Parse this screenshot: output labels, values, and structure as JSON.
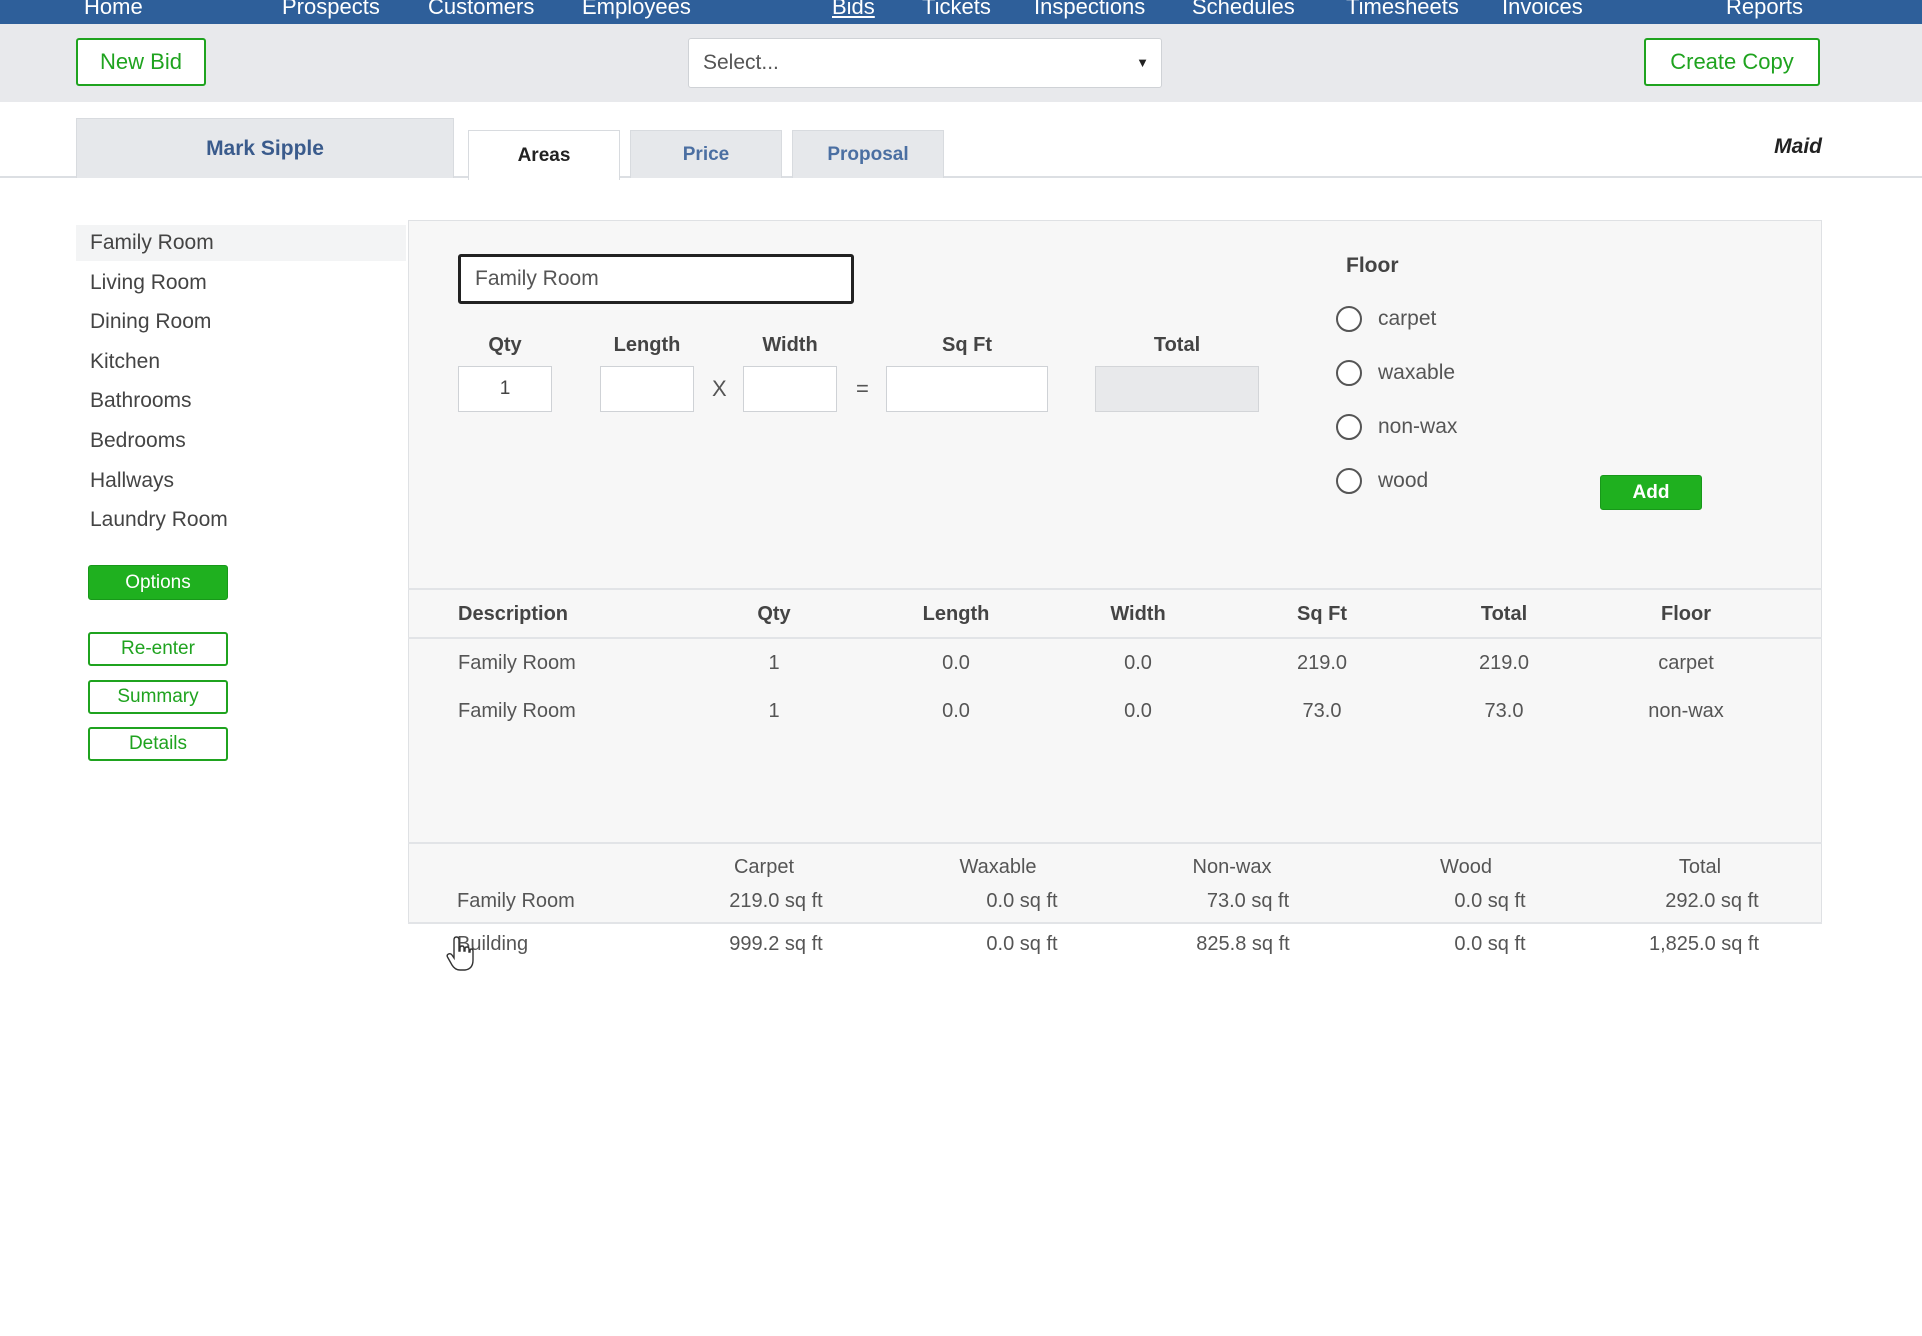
{
  "nav": {
    "items": [
      {
        "label": "Home",
        "active": false
      },
      {
        "label": "Prospects",
        "active": false
      },
      {
        "label": "Customers",
        "active": false
      },
      {
        "label": "Employees",
        "active": false
      },
      {
        "label": "Bids",
        "active": true
      },
      {
        "label": "Tickets",
        "active": false
      },
      {
        "label": "Inspections",
        "active": false
      },
      {
        "label": "Schedules",
        "active": false
      },
      {
        "label": "Timesheets",
        "active": false
      },
      {
        "label": "Invoices",
        "active": false
      },
      {
        "label": "Reports",
        "active": false
      }
    ]
  },
  "toolbar": {
    "new_bid_label": "New Bid",
    "select_placeholder": "Select...",
    "create_copy_label": "Create Copy"
  },
  "header": {
    "customer_name": "Mark Sipple",
    "tabs": [
      {
        "label": "Areas",
        "active": true
      },
      {
        "label": "Price",
        "active": false
      },
      {
        "label": "Proposal",
        "active": false
      }
    ],
    "plan_label": "Maid"
  },
  "sidebar": {
    "rooms": [
      "Family Room",
      "Living Room",
      "Dining Room",
      "Kitchen",
      "Bathrooms",
      "Bedrooms",
      "Hallways",
      "Laundry Room"
    ],
    "selected_room": "Family Room",
    "options_label": "Options",
    "reenter_label": "Re-enter",
    "summary_label": "Summary",
    "details_label": "Details"
  },
  "form": {
    "area_name_value": "Family Room",
    "qty_label": "Qty",
    "qty_value": "1",
    "length_label": "Length",
    "length_value": "",
    "times_symbol": "X",
    "width_label": "Width",
    "width_value": "",
    "equals_symbol": "=",
    "sqft_label": "Sq Ft",
    "sqft_value": "",
    "total_label": "Total",
    "total_value": "",
    "floor_title": "Floor",
    "floor_options": [
      "carpet",
      "waxable",
      "non-wax",
      "wood"
    ],
    "add_label": "Add"
  },
  "table": {
    "headers": [
      "Description",
      "Qty",
      "Length",
      "Width",
      "Sq Ft",
      "Total",
      "Floor"
    ],
    "rows": [
      [
        "Family Room",
        "1",
        "0.0",
        "0.0",
        "219.0",
        "219.0",
        "carpet"
      ],
      [
        "Family Room",
        "1",
        "0.0",
        "0.0",
        "73.0",
        "73.0",
        "non-wax"
      ]
    ]
  },
  "summary": {
    "headers": [
      "Carpet",
      "Waxable",
      "Non-wax",
      "Wood",
      "Total"
    ],
    "rows": [
      {
        "label": "Family Room",
        "values": [
          "219.0 sq ft",
          "0.0 sq ft",
          "73.0 sq ft",
          "0.0 sq ft",
          "292.0 sq ft"
        ]
      },
      {
        "label": "Building",
        "values": [
          "999.2 sq ft",
          "0.0 sq ft",
          "825.8 sq ft",
          "0.0 sq ft",
          "1,825.0 sq ft"
        ]
      }
    ]
  },
  "colors": {
    "nav_bg": "#2e5f9a",
    "accent_green": "#1fb01f",
    "tab_text_blue": "#4b6fa2"
  }
}
